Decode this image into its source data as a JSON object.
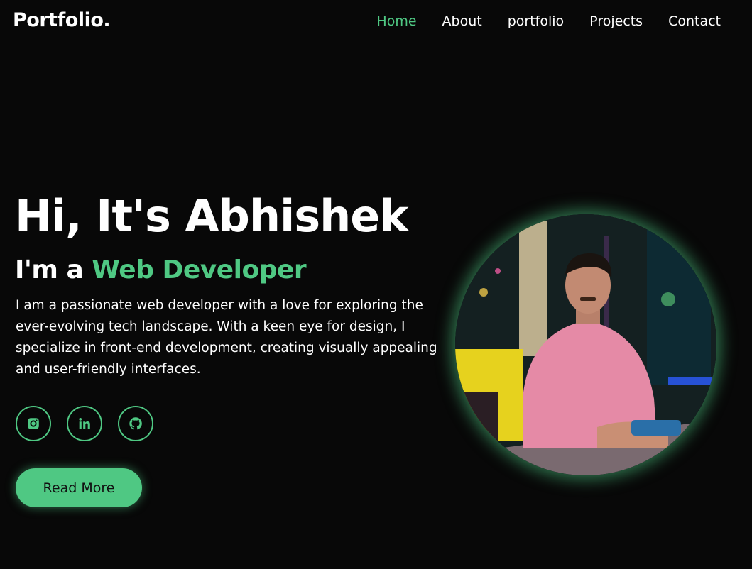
{
  "header": {
    "logo": "Portfolio.",
    "nav": [
      {
        "label": "Home",
        "active": true
      },
      {
        "label": "About",
        "active": false
      },
      {
        "label": "portfolio",
        "active": false
      },
      {
        "label": "Projects",
        "active": false
      },
      {
        "label": "Contact",
        "active": false
      }
    ]
  },
  "hero": {
    "title": "Hi, It's Abhishek",
    "subtitle_prefix": "I'm a ",
    "subtitle_role": "Web Developer",
    "description": "I am a passionate web developer with a love for exploring the ever-evolving tech landscape. With a keen eye for design, I specialize in front-end development, creating visually appealing and user-friendly interfaces.",
    "button_label": "Read More",
    "socials": [
      {
        "icon": "instagram-icon"
      },
      {
        "icon": "linkedin-icon"
      },
      {
        "icon": "github-icon"
      }
    ]
  },
  "colors": {
    "background": "#080808",
    "accent": "#4fc883",
    "text": "#ffffff"
  }
}
